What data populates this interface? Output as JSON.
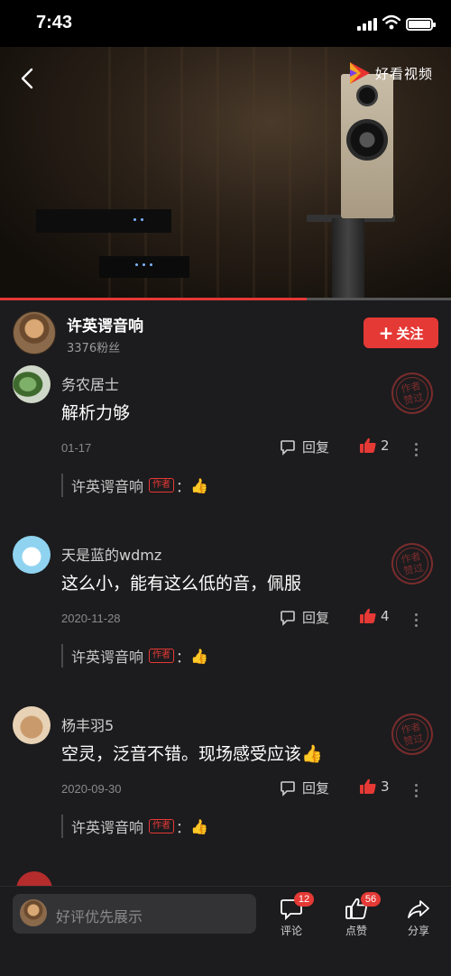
{
  "status_bar": {
    "time": "7:43"
  },
  "video": {
    "logo_text": "好看视频",
    "progress": 0.68,
    "back_icon": "chevron-left-icon"
  },
  "author": {
    "name": "许英谔音响",
    "fans": "3376粉丝",
    "follow_label": "关注"
  },
  "comments": [
    {
      "user": "务农居士",
      "text": "解析力够",
      "date": "01-17",
      "reply_label": "回复",
      "likes": "2",
      "stamp": [
        "作者",
        "赞过"
      ],
      "author_reply": {
        "name": "许英谔音响",
        "tag": "作者",
        "sep": "：",
        "content": "👍"
      }
    },
    {
      "user": "天是蓝的wdmz",
      "text": "这么小，能有这么低的音，佩服",
      "date": "2020-11-28",
      "reply_label": "回复",
      "likes": "4",
      "stamp": [
        "作者",
        "赞过"
      ],
      "author_reply": {
        "name": "许英谔音响",
        "tag": "作者",
        "sep": "：",
        "content": "👍"
      }
    },
    {
      "user": "杨丰羽5",
      "text": "空灵，泛音不错。现场感受应该👍",
      "date": "2020-09-30",
      "reply_label": "回复",
      "likes": "3",
      "stamp": [
        "作者",
        "赞过"
      ],
      "author_reply": {
        "name": "许英谔音响",
        "tag": "作者",
        "sep": "：",
        "content": "👍"
      }
    }
  ],
  "bottom_bar": {
    "input_placeholder": "好评优先展示",
    "comment_label": "评论",
    "comment_count": "12",
    "like_label": "点赞",
    "like_count": "56",
    "share_label": "分享"
  },
  "colors": {
    "accent": "#e53935",
    "background": "#1c1c1e"
  }
}
